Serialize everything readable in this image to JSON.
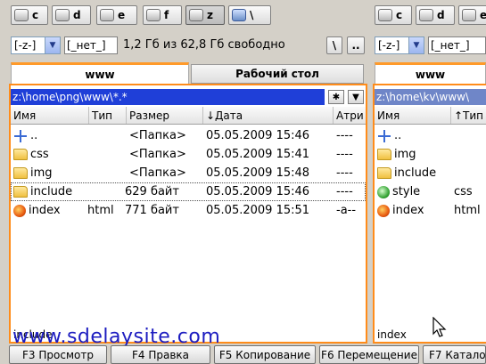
{
  "left_drives": [
    {
      "label": "c",
      "type": "drive",
      "active": false
    },
    {
      "label": "d",
      "type": "cd",
      "active": false
    },
    {
      "label": "e",
      "type": "cd",
      "active": false
    },
    {
      "label": "f",
      "type": "drive",
      "active": false
    },
    {
      "label": "z",
      "type": "drive",
      "active": true
    },
    {
      "label": "\\",
      "type": "net",
      "active": false
    }
  ],
  "right_drives": [
    {
      "label": "c",
      "type": "drive"
    },
    {
      "label": "d",
      "type": "cd"
    },
    {
      "label": "e",
      "type": "cd"
    }
  ],
  "left_info": {
    "drive_combo": "[-z-]",
    "volume_label": "[_нет_]",
    "free_space": "1,2 Гб из 62,8 Гб свободно",
    "root_btn": "\\",
    "up_btn": ".."
  },
  "right_info": {
    "drive_combo": "[-z-]",
    "volume_label": "[_нет_]"
  },
  "left_panel": {
    "tabs": [
      {
        "label": "www",
        "active": true
      },
      {
        "label": "Рабочий стол",
        "active": false
      }
    ],
    "path": "z:\\home\\png\\www\\*.*",
    "path_btn1": "✱",
    "path_btn2": "▼",
    "columns": {
      "name": "Имя",
      "ext": "Тип",
      "size": "Размер",
      "date": "↓Дата",
      "attr": "Атри"
    },
    "files": [
      {
        "icon": "up",
        "name": "..",
        "ext": "",
        "size": "<Папка>",
        "date": "05.05.2009 15:46",
        "attr": "----"
      },
      {
        "icon": "folder",
        "name": "css",
        "ext": "",
        "size": "<Папка>",
        "date": "05.05.2009 15:41",
        "attr": "----"
      },
      {
        "icon": "folder",
        "name": "img",
        "ext": "",
        "size": "<Папка>",
        "date": "05.05.2009 15:48",
        "attr": "----"
      },
      {
        "icon": "folder",
        "name": "include",
        "ext": "",
        "size": "629 байт",
        "date": "05.05.2009 15:46",
        "attr": "----"
      },
      {
        "icon": "ff",
        "name": "index",
        "ext": "html",
        "size": "771 байт",
        "date": "05.05.2009 15:51",
        "attr": "-a--"
      }
    ],
    "status": "include"
  },
  "right_panel": {
    "tab": "www",
    "path": "z:\\home\\kv\\www\\",
    "columns": {
      "name": "Имя",
      "ext": "↑Тип"
    },
    "files": [
      {
        "icon": "up",
        "name": "..",
        "ext": ""
      },
      {
        "icon": "folder",
        "name": "img",
        "ext": ""
      },
      {
        "icon": "folder",
        "name": "include",
        "ext": ""
      },
      {
        "icon": "css",
        "name": "style",
        "ext": "css"
      },
      {
        "icon": "ff",
        "name": "index",
        "ext": "html"
      }
    ],
    "status": "index"
  },
  "function_keys": [
    "F3 Просмотр",
    "F4 Правка",
    "F5 Копирование",
    "F6 Перемещение",
    "F7 Каталог"
  ],
  "watermark": "www.sdelaysite.com"
}
